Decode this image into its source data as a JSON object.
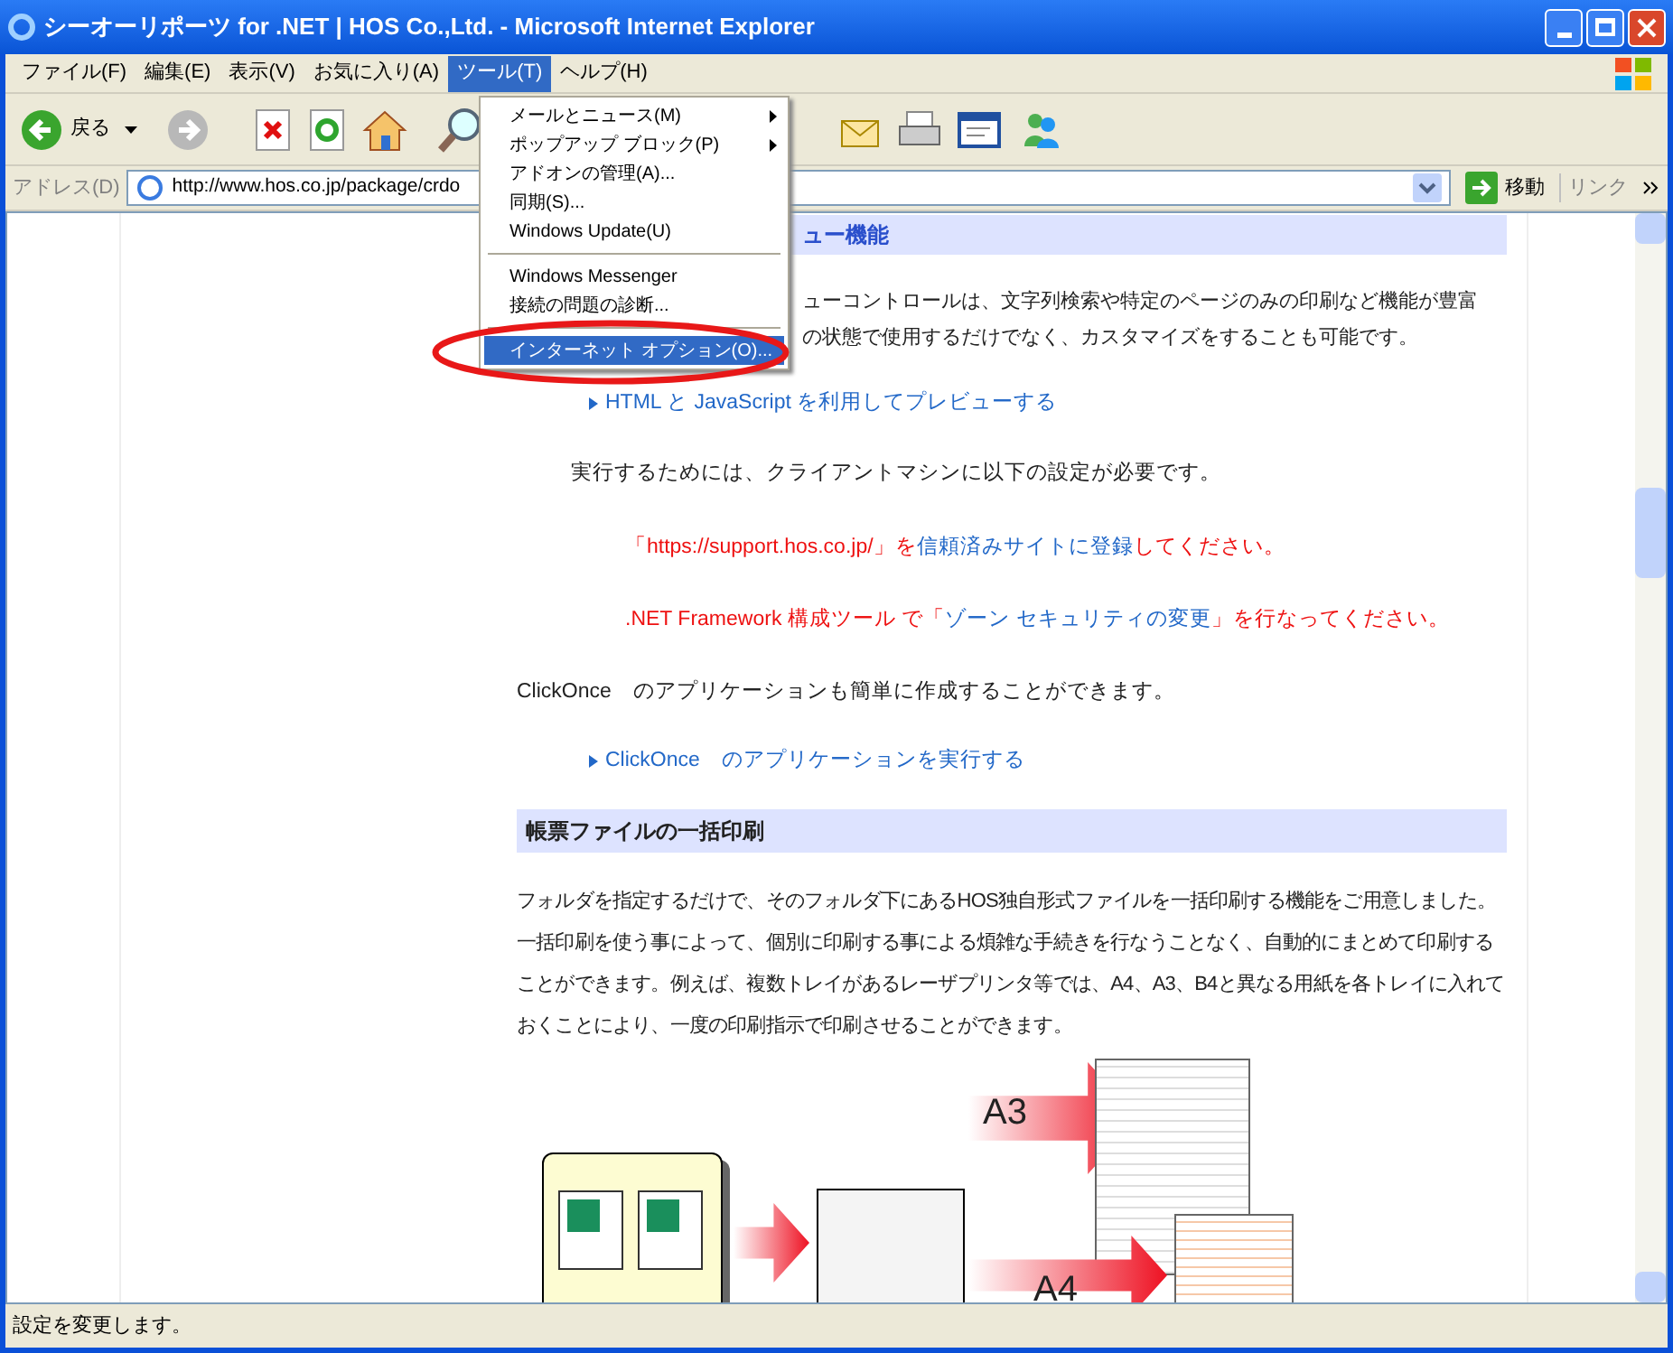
{
  "window": {
    "title": "シーオーリポーツ for .NET | HOS Co.,Ltd. - Microsoft Internet Explorer"
  },
  "menu_bar": [
    {
      "label": "ファイル(F)",
      "selected": false
    },
    {
      "label": "編集(E)",
      "selected": false
    },
    {
      "label": "表示(V)",
      "selected": false
    },
    {
      "label": "お気に入り(A)",
      "selected": false
    },
    {
      "label": "ツール(T)",
      "selected": true
    },
    {
      "label": "ヘルプ(H)",
      "selected": false
    }
  ],
  "toolbar": {
    "back_label": "戻る"
  },
  "address_bar": {
    "label": "アドレス(D)",
    "value": "http://www.hos.co.jp/package/crdo",
    "go_label": "移動",
    "links_label": "リンク"
  },
  "tools_menu": [
    {
      "kind": "item",
      "label": "メールとニュース(M)",
      "submenu": true,
      "selected": false
    },
    {
      "kind": "item",
      "label": "ポップアップ ブロック(P)",
      "submenu": true,
      "selected": false
    },
    {
      "kind": "item",
      "label": "アドオンの管理(A)...",
      "submenu": false,
      "selected": false
    },
    {
      "kind": "item",
      "label": "同期(S)...",
      "submenu": false,
      "selected": false
    },
    {
      "kind": "item",
      "label": "Windows Update(U)",
      "submenu": false,
      "selected": false
    },
    {
      "kind": "separator"
    },
    {
      "kind": "item",
      "label": "Windows Messenger",
      "submenu": false,
      "selected": false
    },
    {
      "kind": "item",
      "label": "接続の問題の診断...",
      "submenu": false,
      "selected": false
    },
    {
      "kind": "separator"
    },
    {
      "kind": "item",
      "label": "インターネット オプション(O)...",
      "submenu": false,
      "selected": true
    }
  ],
  "page": {
    "heading_1": "ュー機能",
    "intro_lines": [
      "ューコントロールは、文字列検索や特定のページのみの印刷など機能が豊富",
      "の状態で使用するだけでなく、カスタマイズをすることも可能です。"
    ],
    "link_1": "HTML と JavaScript を利用してプレビューする",
    "requirement": "実行するためには、クライアントマシンに以下の設定が必要です。",
    "steps": [
      [
        {
          "kind": "text",
          "text": "「https://support.hos.co.jp/」を"
        },
        {
          "kind": "link",
          "text": "信頼済みサイトに登録"
        },
        {
          "kind": "text",
          "text": "してください。"
        }
      ],
      [
        {
          "kind": "text",
          "text": ".NET Framework 構成ツール で「"
        },
        {
          "kind": "link",
          "text": "ゾーン セキュリティの変更"
        },
        {
          "kind": "text",
          "text": "」を行なってください。"
        }
      ]
    ],
    "clickonce_text": "ClickOnce　のアプリケーションも簡単に作成することができます。",
    "link_2": "ClickOnce　のアプリケーションを実行する",
    "heading_2": "帳票ファイルの一括印刷",
    "paragraph": "フォルダを指定するだけで、そのフォルダ下にあるHOS独自形式ファイルを一括印刷する機能をご用意しました。一括印刷を使う事によって、個別に印刷する事による煩雑な手続きを行なうことなく、自動的にまとめて印刷することができます。例えば、複数トレイがあるレーザプリンタ等では、A4、A3、B4と異なる用紙を各トレイに入れておくことにより、一度の印刷指示で印刷させることができます。",
    "figure_labels": [
      "A3",
      "A4"
    ]
  },
  "status_bar": {
    "text": "設定を変更します。"
  }
}
